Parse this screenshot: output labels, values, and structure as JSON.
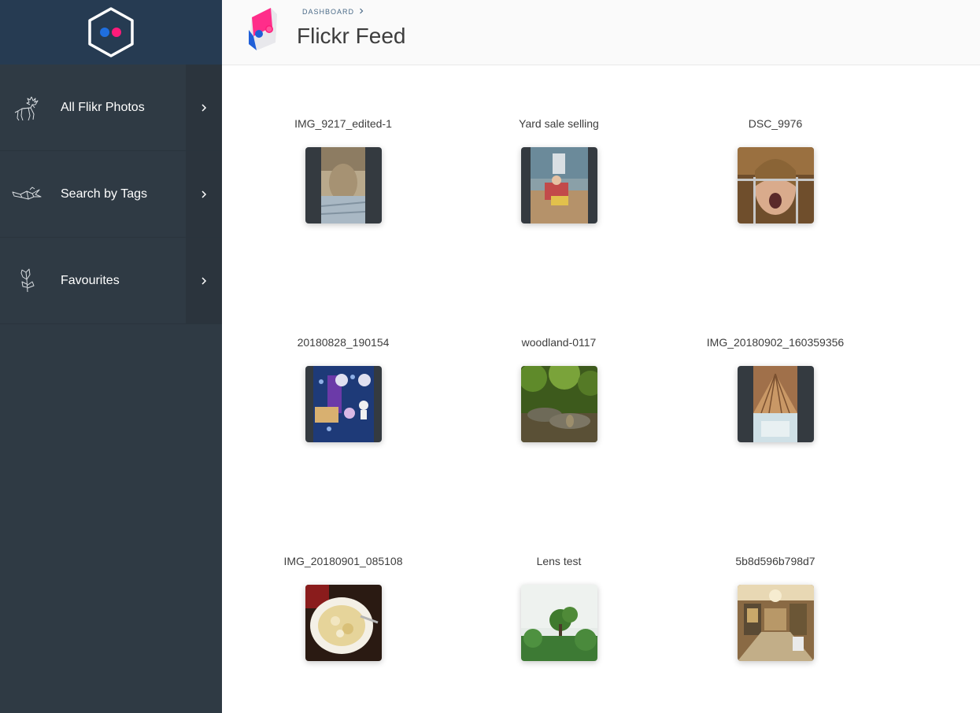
{
  "sidebar": {
    "logo_icon": "flickr-hexagon-logo",
    "items": [
      {
        "label": "All Flikr Photos",
        "icon": "deer-icon"
      },
      {
        "label": "Search by Tags",
        "icon": "bird-icon"
      },
      {
        "label": "Favourites",
        "icon": "flower-icon"
      }
    ]
  },
  "header": {
    "breadcrumb": "DASHBOARD",
    "title": "Flickr Feed"
  },
  "photos": [
    {
      "title": "IMG_9217_edited-1"
    },
    {
      "title": "Yard sale selling"
    },
    {
      "title": "DSC_9976"
    },
    {
      "title": "20180828_190154"
    },
    {
      "title": "woodland-0117"
    },
    {
      "title": "IMG_20180902_160359356"
    },
    {
      "title": "IMG_20180901_085108"
    },
    {
      "title": "Lens test"
    },
    {
      "title": "5b8d596b798d7"
    }
  ],
  "colors": {
    "sidebar_bg": "#2f3a44",
    "sidebar_logo_bg": "#263b52",
    "flickr_blue": "#1f6fe0",
    "flickr_pink": "#ff1b7a"
  }
}
